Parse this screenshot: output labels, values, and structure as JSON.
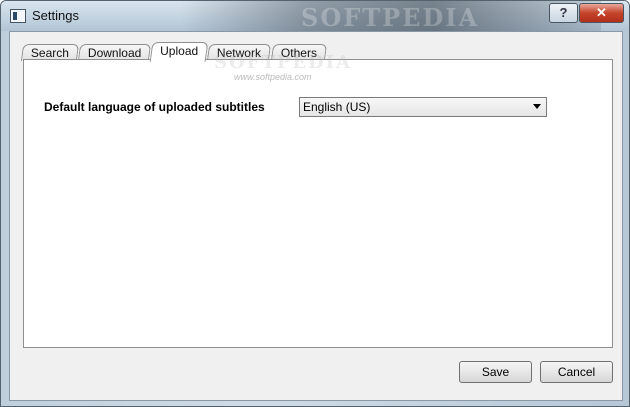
{
  "window": {
    "title": "Settings",
    "help_label": "?",
    "close_label": "✕",
    "watermark": "SOFTPEDIA"
  },
  "tabs": [
    {
      "label": "Search",
      "active": false
    },
    {
      "label": "Download",
      "active": false
    },
    {
      "label": "Upload",
      "active": true
    },
    {
      "label": "Network",
      "active": false
    },
    {
      "label": "Others",
      "active": false
    }
  ],
  "upload": {
    "language_label": "Default language of uploaded subtitles",
    "language_value": "English (US)"
  },
  "panel_watermark": {
    "brand": "SOFTPEDIA",
    "url": "www.softpedia.com"
  },
  "buttons": {
    "save": "Save",
    "cancel": "Cancel"
  },
  "icons": {
    "app": "settings-window-icon",
    "dropdown": "chevron-down-icon"
  }
}
